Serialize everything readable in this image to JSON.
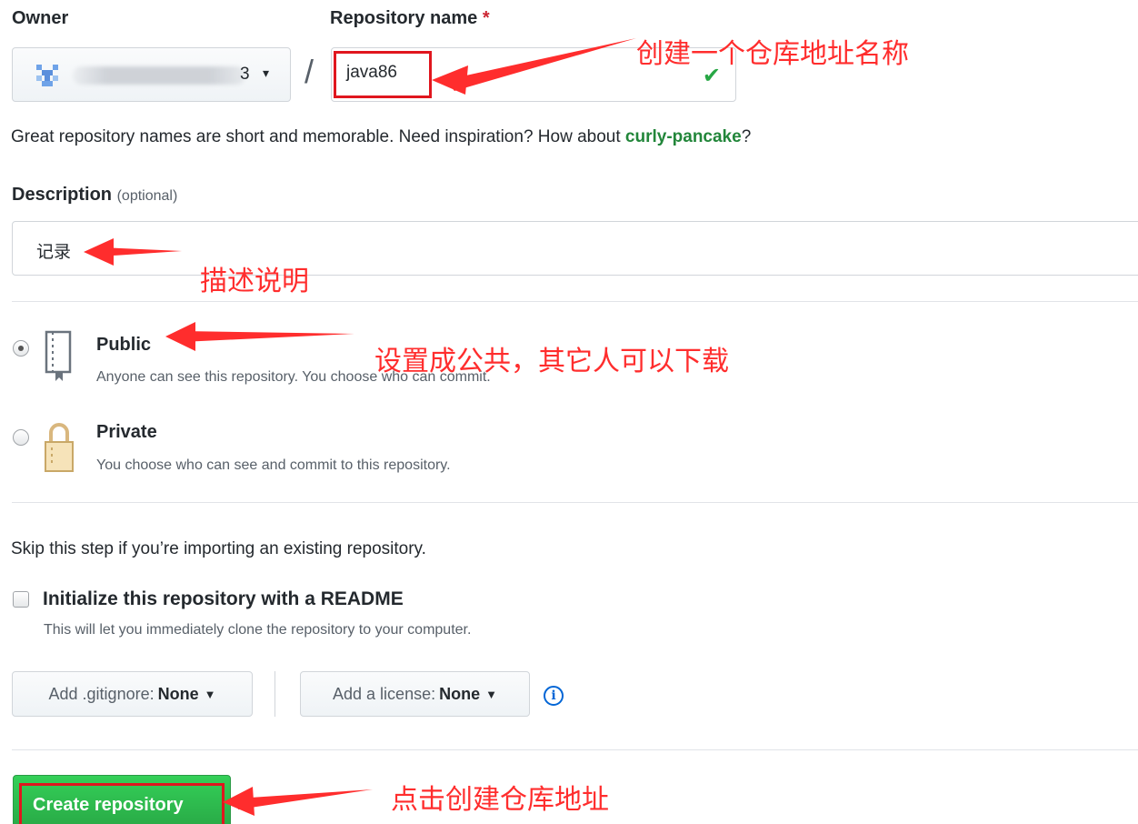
{
  "owner": {
    "label": "Owner",
    "name_fragment": "3",
    "caret": "▾"
  },
  "repo_name": {
    "label": "Repository name",
    "required_mark": "*",
    "value": "java86",
    "valid_icon": "check-icon"
  },
  "separator": "/",
  "hint": {
    "prefix": "Great repository names are short and memorable. Need inspiration? How about ",
    "suggestion": "curly-pancake",
    "suffix": "?"
  },
  "description": {
    "label": "Description",
    "optional": "(optional)",
    "value": "记录"
  },
  "visibility": [
    {
      "title": "Public",
      "description": "Anyone can see this repository. You choose who can commit.",
      "icon": "repo-book-icon",
      "checked": true
    },
    {
      "title": "Private",
      "description": "You choose who can see and commit to this repository.",
      "icon": "lock-icon",
      "checked": false
    }
  ],
  "import_hint": "Skip this step if you’re importing an existing repository.",
  "readme": {
    "title": "Initialize this repository with a README",
    "description": "This will let you immediately clone the repository to your computer.",
    "checked": false
  },
  "gitignore": {
    "label": "Add .gitignore:",
    "value": "None"
  },
  "license": {
    "label": "Add a license:",
    "value": "None"
  },
  "info_icon": "info-icon",
  "create_button": "Create repository",
  "annotations": {
    "repo_name": "创建一个仓库地址名称",
    "description": "描述说明",
    "public": "设置成公共，其它人可以下载",
    "create": "点击创建仓库地址"
  },
  "colors": {
    "annotation": "#ff2d2d",
    "create_button": "#2ea44f",
    "suggestion": "#22863a",
    "link": "#0366d6"
  }
}
